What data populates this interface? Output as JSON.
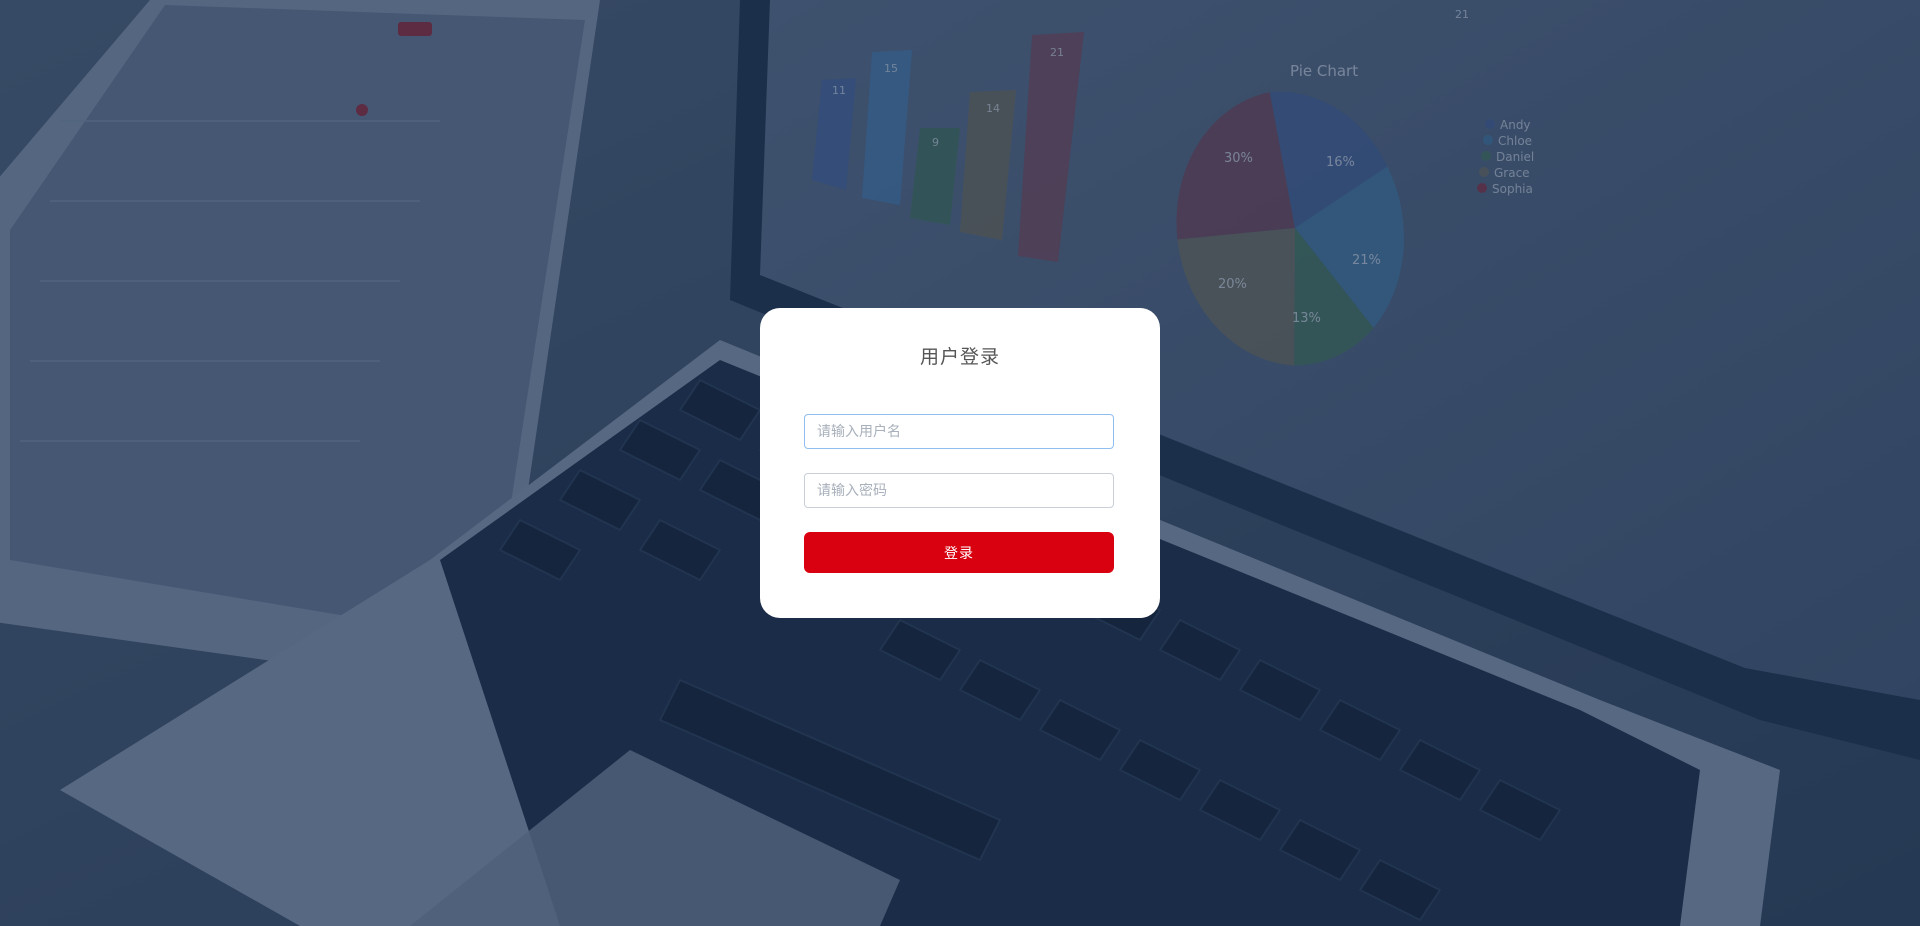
{
  "login": {
    "title": "用户登录",
    "username_placeholder": "请输入用户名",
    "username_value": "",
    "password_placeholder": "请输入密码",
    "password_value": "",
    "submit_label": "登录"
  },
  "background": {
    "chart_title": "Pie Chart",
    "bar_labels": [
      "11",
      "15",
      "9",
      "14",
      "21"
    ],
    "pie_labels": [
      "30%",
      "16%",
      "21%",
      "13%",
      "20%"
    ],
    "legend": [
      "Andy",
      "Chloe",
      "Daniel",
      "Grace",
      "Sophia"
    ],
    "top_number": "21"
  },
  "colors": {
    "accent": "#d9000f",
    "card_bg": "#ffffff",
    "title_text": "#555555",
    "placeholder": "#a8b0bb",
    "focus_border": "#8fbef0"
  }
}
